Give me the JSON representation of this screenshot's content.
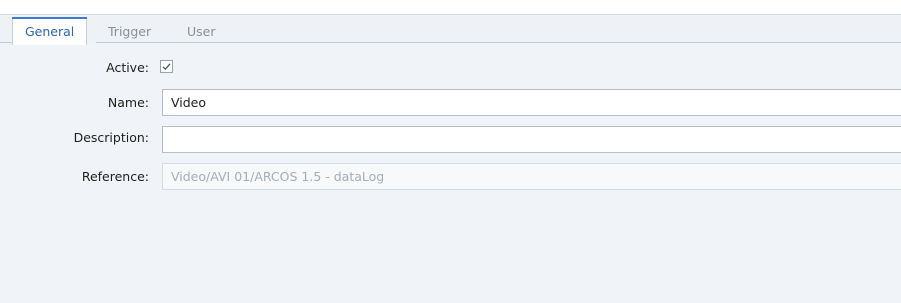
{
  "tabs": [
    {
      "label": "General",
      "active": true
    },
    {
      "label": "Trigger",
      "active": false
    },
    {
      "label": "User",
      "active": false
    }
  ],
  "form": {
    "active": {
      "label": "Active:",
      "checked": true
    },
    "name": {
      "label": "Name:",
      "value": "Video"
    },
    "description": {
      "label": "Description:",
      "value": ""
    },
    "reference": {
      "label": "Reference:",
      "value": "Video/AVI 01/ARCOS 1.5 - dataLog",
      "readonly": true
    }
  },
  "colors": {
    "accent": "#3c7bd1",
    "active_tab_text": "#2b66b1",
    "panel_background": "#f0f3f7"
  }
}
